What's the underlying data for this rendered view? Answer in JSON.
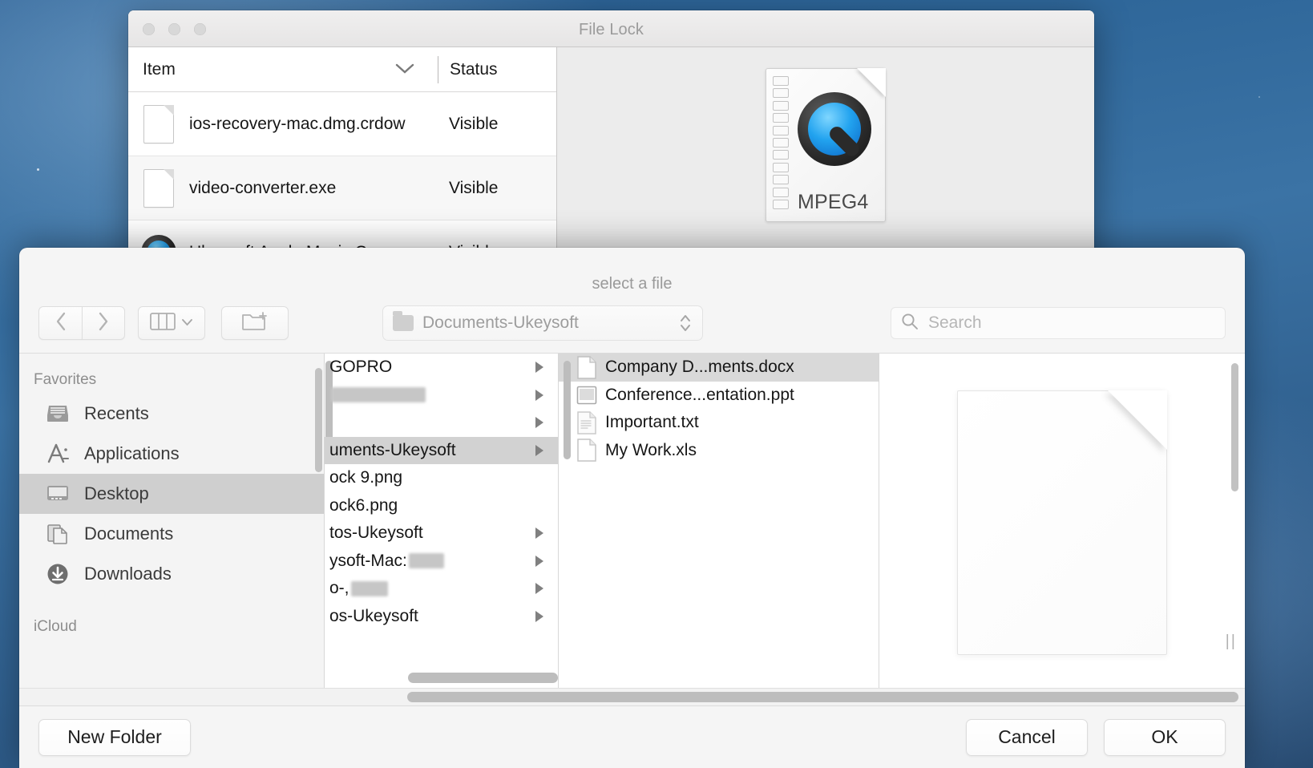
{
  "desktop": {
    "wallpaper": "blue-sky-gradient"
  },
  "background_window": {
    "title": "File Lock",
    "columns": {
      "item": "Item",
      "status": "Status"
    },
    "rows": [
      {
        "name": "ios-recovery-mac.dmg.crdow",
        "status": "Visible",
        "icon": "document-icon"
      },
      {
        "name": "video-converter.exe",
        "status": "Visible",
        "icon": "document-icon"
      },
      {
        "name": "Ukeysoft Apple Music Conv",
        "status": "Visible",
        "icon": "quicktime-icon"
      }
    ],
    "preview": {
      "icon": "quicktime-mpeg4-file-icon",
      "label": "MPEG4"
    }
  },
  "picker": {
    "title": "select a file",
    "toolbar": {
      "back_icon": "chevron-left-icon",
      "forward_icon": "chevron-right-icon",
      "view_icon": "column-view-icon",
      "view_chevron_icon": "chevron-down-icon",
      "new_folder_icon": "new-folder-icon",
      "path_label": "Documents-Ukeysoft",
      "path_folder_icon": "folder-icon",
      "path_stepper_icon": "stepper-updown-icon",
      "search_placeholder": "Search",
      "search_value": "",
      "search_icon": "search-icon"
    },
    "sidebar": {
      "groups": [
        {
          "label": "Favorites",
          "items": [
            {
              "label": "Recents",
              "icon": "recents-icon",
              "selected": false
            },
            {
              "label": "Applications",
              "icon": "applications-icon",
              "selected": false
            },
            {
              "label": "Desktop",
              "icon": "desktop-icon",
              "selected": true
            },
            {
              "label": "Documents",
              "icon": "documents-icon",
              "selected": false
            },
            {
              "label": "Downloads",
              "icon": "downloads-icon",
              "selected": false
            }
          ]
        },
        {
          "label": "iCloud",
          "items": []
        }
      ]
    },
    "column1": {
      "rows": [
        {
          "label": "GOPRO",
          "has_arrow": true,
          "selected": false,
          "redacted": false
        },
        {
          "label": "",
          "has_arrow": true,
          "selected": false,
          "redacted": true
        },
        {
          "label": "",
          "has_arrow": true,
          "selected": false,
          "redacted": false
        },
        {
          "label": "uments-Ukeysoft",
          "has_arrow": true,
          "selected": true,
          "redacted": false
        },
        {
          "label": "ock 9.png",
          "has_arrow": false,
          "selected": false,
          "redacted": false
        },
        {
          "label": "ock6.png",
          "has_arrow": false,
          "selected": false,
          "redacted": false
        },
        {
          "label": "tos-Ukeysoft",
          "has_arrow": true,
          "selected": false,
          "redacted": false
        },
        {
          "label": "ysoft-Mac:",
          "has_arrow": true,
          "selected": false,
          "redacted": true
        },
        {
          "label": "o-,",
          "has_arrow": true,
          "selected": false,
          "redacted": true
        },
        {
          "label": "os-Ukeysoft",
          "has_arrow": true,
          "selected": false,
          "redacted": false
        }
      ]
    },
    "column2": {
      "rows": [
        {
          "label": "Company D...ments.docx",
          "icon": "word-document-icon",
          "selected": true
        },
        {
          "label": "Conference...entation.ppt",
          "icon": "powerpoint-icon",
          "selected": false
        },
        {
          "label": "Important.txt",
          "icon": "text-document-icon",
          "selected": false
        },
        {
          "label": "My Work.xls",
          "icon": "excel-icon",
          "selected": false
        }
      ]
    },
    "preview": {
      "icon": "blank-document-preview",
      "resize_handle_icon": "resize-grip-icon"
    },
    "footer": {
      "new_folder": "New Folder",
      "cancel": "Cancel",
      "ok": "OK"
    }
  }
}
